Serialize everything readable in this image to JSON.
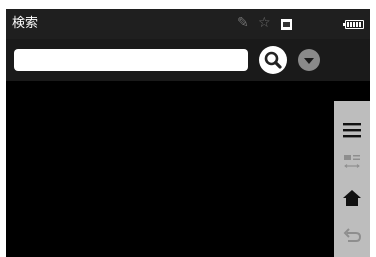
{
  "status_bar": {
    "title": "検索",
    "icons": [
      "pencil-icon",
      "star-icon",
      "image-icon",
      "battery-icon"
    ],
    "colors": {
      "background": "#1f1f1f",
      "title_text": "#ffffff",
      "inactive_icon": "#6f6f6f"
    }
  },
  "search_bar": {
    "input_value": "",
    "input_placeholder": "",
    "search_button_icon": "search-icon",
    "dropdown_button_icon": "chevron-down-icon",
    "colors": {
      "background": "#1a1a1a",
      "dropdown_button": "#8a8a8a"
    }
  },
  "side_panel": {
    "buttons": [
      {
        "icon": "menu-icon",
        "enabled": true
      },
      {
        "icon": "list-toggle-icon",
        "enabled": false
      },
      {
        "icon": "home-icon",
        "enabled": true
      },
      {
        "icon": "back-icon",
        "enabled": false
      }
    ],
    "colors": {
      "background": "#bdbdbd",
      "enabled_icon": "#111111",
      "disabled_icon": "#8e8e8e"
    }
  },
  "content": {
    "background": "#000000"
  }
}
